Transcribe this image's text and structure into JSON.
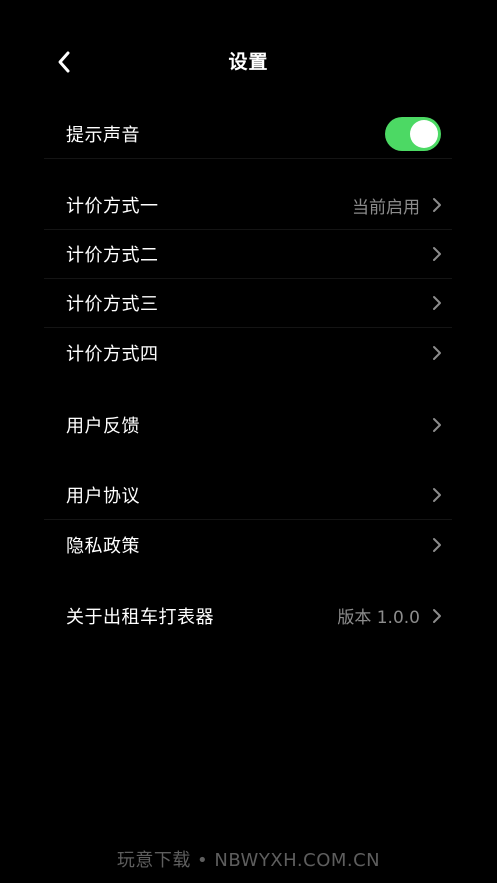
{
  "header": {
    "title": "设置",
    "back_icon": "chevron-left-icon"
  },
  "colors": {
    "background": "#000000",
    "toggle_on": "#4cd964",
    "secondary_text": "#8c8c8c",
    "watermark": "#5e5e5e"
  },
  "settings": {
    "sound": {
      "label": "提示声音",
      "enabled": true
    },
    "pricing": [
      {
        "label": "计价方式一",
        "value": "当前启用"
      },
      {
        "label": "计价方式二",
        "value": ""
      },
      {
        "label": "计价方式三",
        "value": ""
      },
      {
        "label": "计价方式四",
        "value": ""
      }
    ],
    "feedback": {
      "label": "用户反馈"
    },
    "agreement": {
      "label": "用户协议"
    },
    "privacy": {
      "label": "隐私政策"
    },
    "about": {
      "label": "关于出租车打表器",
      "value": "版本 1.0.0"
    }
  },
  "watermark": "玩意下载 • NBWYXH.COM.CN"
}
